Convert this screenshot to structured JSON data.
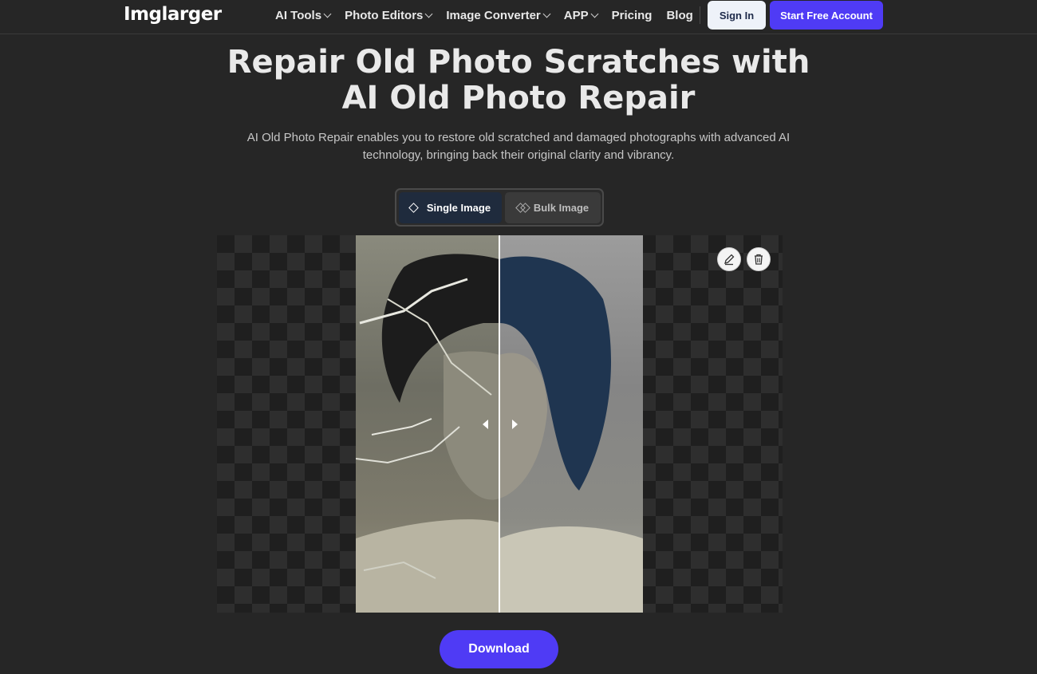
{
  "nav": {
    "logo": "Imglarger",
    "items": [
      {
        "label": "AI Tools"
      },
      {
        "label": "Photo Editors"
      },
      {
        "label": "Image Converter"
      },
      {
        "label": "APP"
      },
      {
        "label": "Pricing"
      },
      {
        "label": "Blog"
      }
    ],
    "sign_in": "Sign In",
    "start_free": "Start Free Account"
  },
  "hero": {
    "title_line1": "Repair Old Photo Scratches with",
    "title_line2": "AI Old Photo Repair",
    "subtitle": "AI Old Photo Repair enables you to restore old scratched and damaged photographs with advanced AI technology, bringing back their original clarity and vibrancy."
  },
  "mode": {
    "single_label": "Single Image",
    "bulk_label": "Bulk Image"
  },
  "editor": {
    "actions": [
      "edit-icon",
      "trash-icon"
    ]
  },
  "download_label": "Download",
  "colors": {
    "background": "#262626",
    "accent": "#4f3bf5"
  }
}
